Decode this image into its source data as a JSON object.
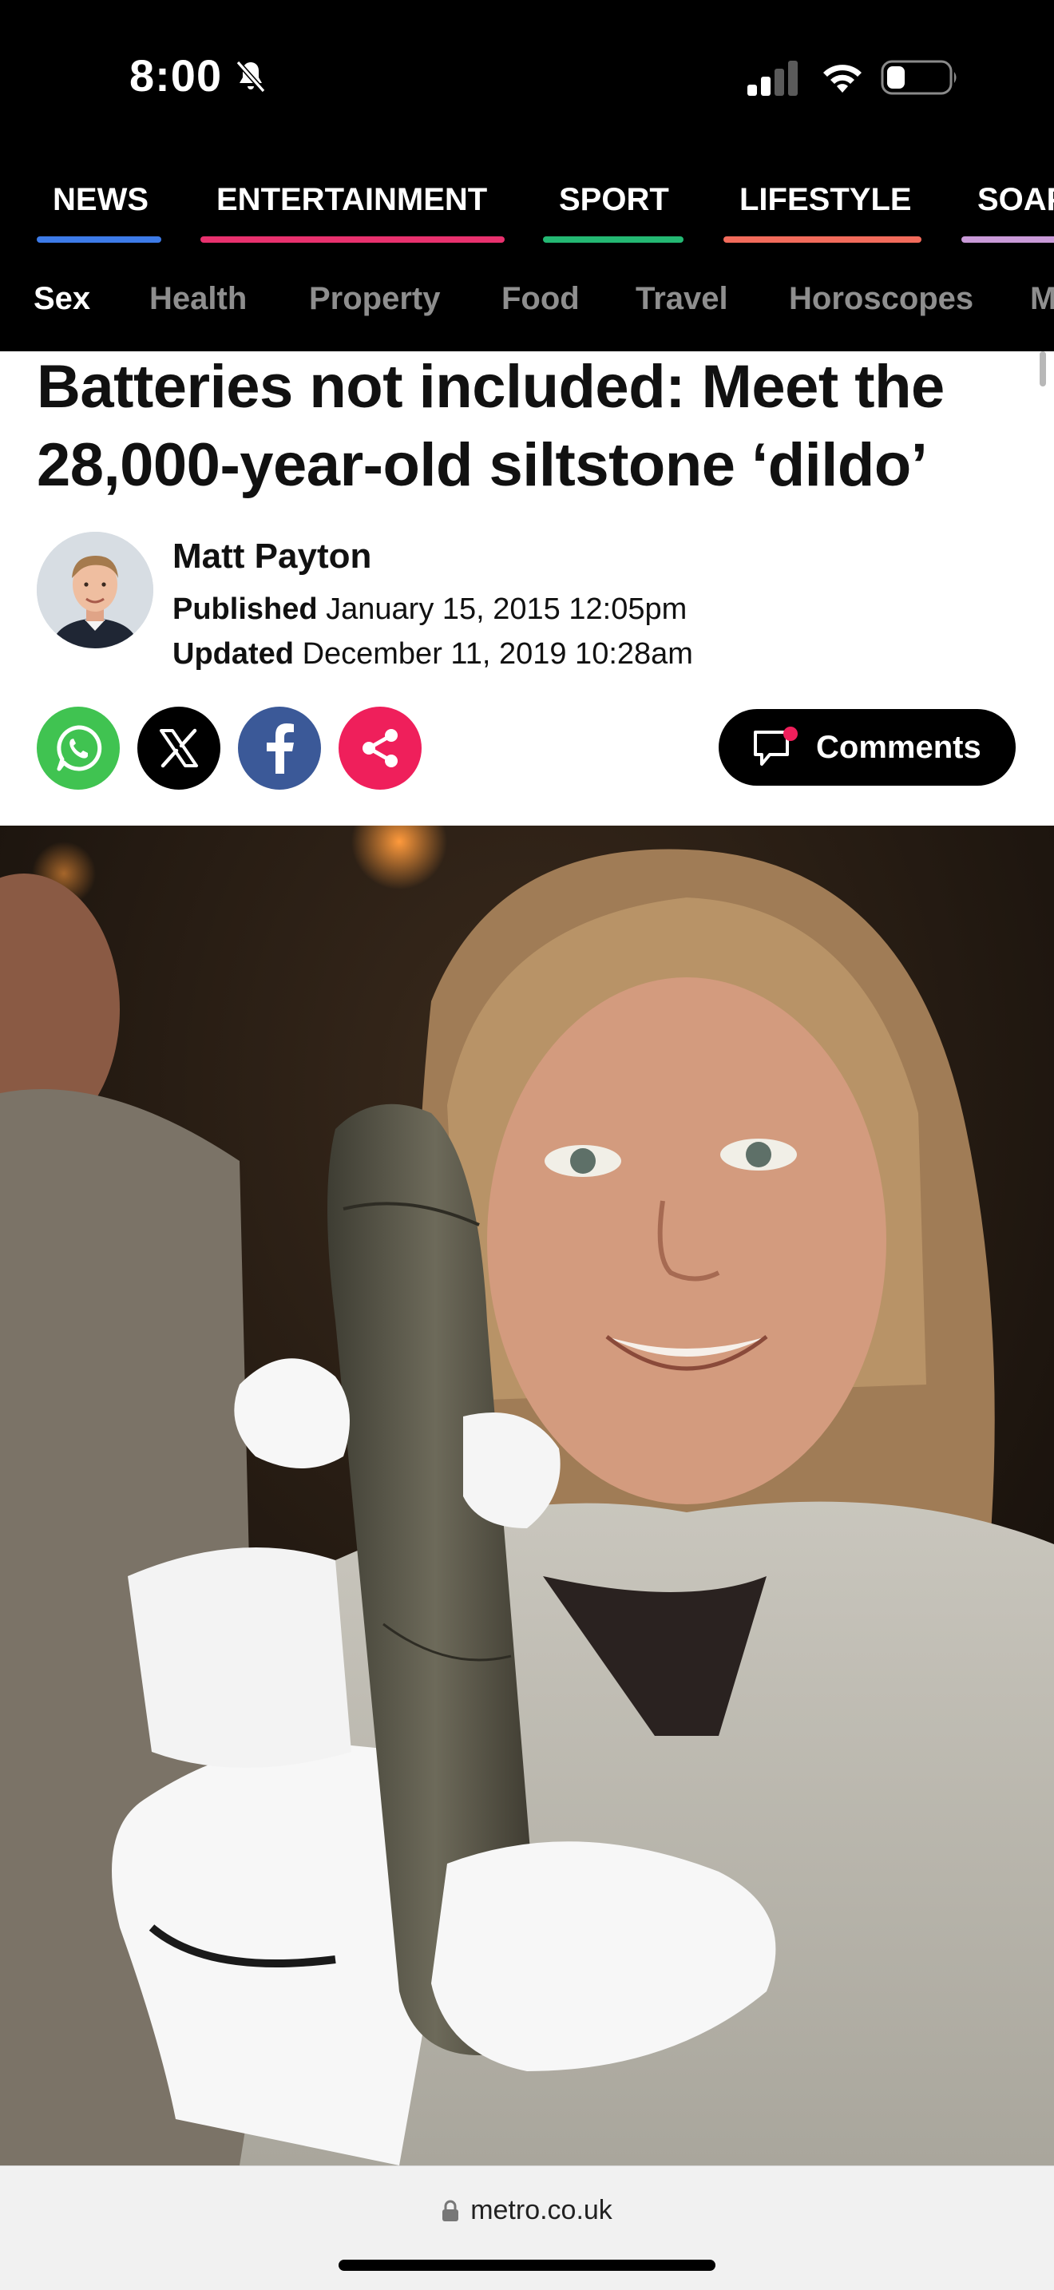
{
  "status_bar": {
    "time": "8:00"
  },
  "primary_nav": {
    "items": [
      {
        "label": "NEWS",
        "color": "#3d7be8"
      },
      {
        "label": "ENTERTAINMENT",
        "color": "#e8316e"
      },
      {
        "label": "SPORT",
        "color": "#24b873"
      },
      {
        "label": "LIFESTYLE",
        "color": "#f26b5b"
      },
      {
        "label": "SOAPS",
        "color": "#c99ad8"
      }
    ]
  },
  "secondary_nav": {
    "items": [
      "Sex",
      "Health",
      "Property",
      "Food",
      "Travel",
      "Horoscopes",
      "M"
    ],
    "active": "Sex"
  },
  "article": {
    "headline_line1": "Batteries not included: Meet the",
    "headline_line2": "28,000-year-old siltstone ‘dildo’",
    "author": "Matt Payton",
    "published_label": "Published",
    "published_value": "January 15, 2015 12:05pm",
    "updated_label": "Updated",
    "updated_value": "December 11, 2019 10:28am",
    "comments_label": "Comments"
  },
  "share": {
    "icons": [
      "whatsapp-icon",
      "x-icon",
      "facebook-icon",
      "share-icon"
    ]
  },
  "colors": {
    "accent_pink": "#ef1f5b",
    "whatsapp": "#40c351",
    "facebook": "#3b5998"
  },
  "browser": {
    "url": "metro.co.uk"
  }
}
